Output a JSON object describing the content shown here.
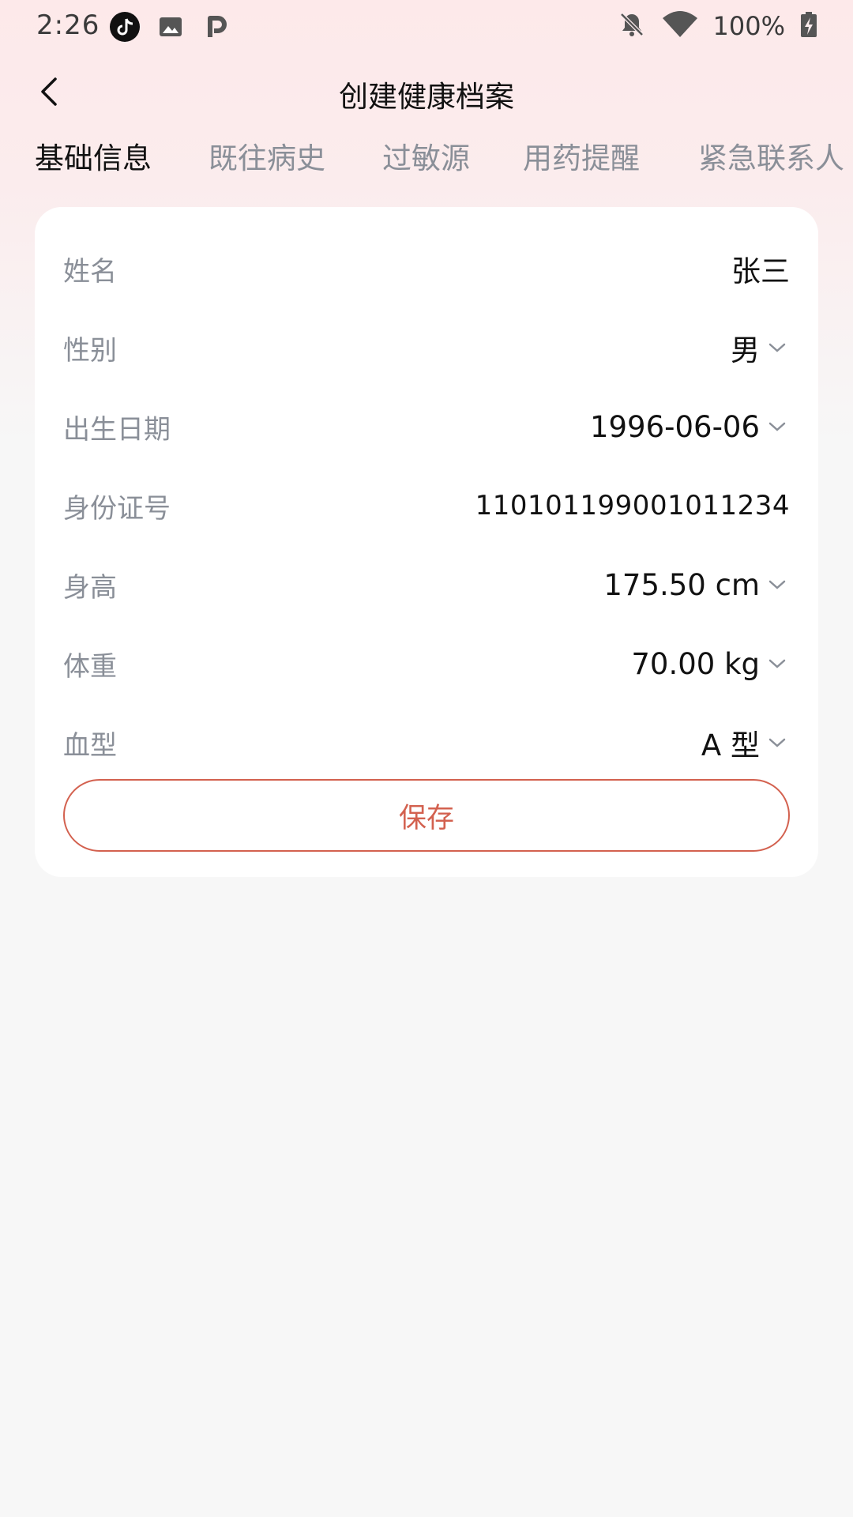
{
  "status_bar": {
    "time": "2:26",
    "battery": "100%",
    "icons": [
      "tiktok-icon",
      "gallery-icon",
      "parking-icon",
      "bell-off-icon",
      "wifi-icon",
      "battery-charging-icon"
    ]
  },
  "header": {
    "title": "创建健康档案",
    "back_icon": "chevron-left-icon"
  },
  "tabs": [
    {
      "label": "基础信息",
      "active": true
    },
    {
      "label": "既往病史",
      "active": false
    },
    {
      "label": "过敏源",
      "active": false
    },
    {
      "label": "用药提醒",
      "active": false
    },
    {
      "label": "紧急联系人",
      "active": false
    }
  ],
  "form": {
    "fields": [
      {
        "label": "姓名",
        "value": "张三",
        "dropdown": false
      },
      {
        "label": "性别",
        "value": "男",
        "dropdown": true
      },
      {
        "label": "出生日期",
        "value": "1996-06-06",
        "dropdown": true
      },
      {
        "label": "身份证号",
        "value": "110101199001011234",
        "dropdown": false
      },
      {
        "label": "身高",
        "value": "175.50 cm",
        "dropdown": true
      },
      {
        "label": "体重",
        "value": "70.00 kg",
        "dropdown": true
      },
      {
        "label": "血型",
        "value": "A 型",
        "dropdown": true
      }
    ],
    "save_label": "保存"
  },
  "colors": {
    "accent": "#d3614f",
    "label_gray": "#8a8f98",
    "background": "#f7f7f7",
    "header_tint": "#fde9ea"
  }
}
